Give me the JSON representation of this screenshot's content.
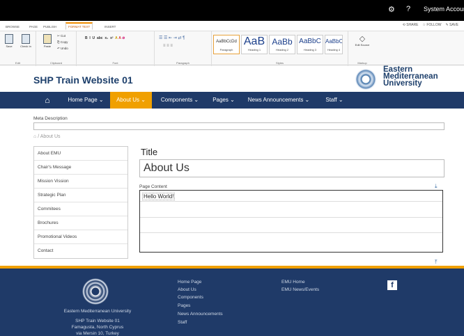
{
  "suitebar": {
    "gear_icon": "gear-icon",
    "help_icon": "help-icon",
    "help": "?",
    "account": "System Account"
  },
  "ribbon_tabs": [
    "BROWSE",
    "PAGE",
    "PUBLISH",
    "FORMAT TEXT",
    "INSERT"
  ],
  "active_ribbon_tab": "FORMAT TEXT",
  "ribbon_actions": {
    "share": "SHARE",
    "follow": "FOLLOW",
    "save": "SAVE"
  },
  "ribbon": {
    "edit_group": {
      "save": "Save",
      "checkin": "Check In",
      "label": "Edit"
    },
    "clipboard": {
      "paste": "Paste",
      "cut": "Cut",
      "copy": "Copy",
      "undo": "Undo",
      "label": "Clipboard"
    },
    "font": {
      "label": "Font"
    },
    "paragraph": {
      "label": "Paragraph"
    },
    "styles": {
      "items": [
        {
          "sample": "AaBbCcDd",
          "name": "Paragraph"
        },
        {
          "sample": "AaB",
          "name": "Heading 1"
        },
        {
          "sample": "AaBb",
          "name": "Heading 2"
        },
        {
          "sample": "AaBbC",
          "name": "Heading 3"
        },
        {
          "sample": "AaBbCc",
          "name": "Heading 4"
        }
      ],
      "label": "Styles"
    },
    "markup": {
      "edit_source": "Edit Source",
      "label": "Markup"
    }
  },
  "site": {
    "title": "SHP Train Website 01",
    "university_line1": "Eastern",
    "university_line2": "Mediterranean",
    "university_line3": "University"
  },
  "topnav": {
    "home_icon": "home-icon",
    "items": [
      "Home Page ⌄",
      "About Us ⌄",
      "Components ⌄",
      "Pages ⌄",
      "News Announcements ⌄",
      "Staff ⌄"
    ],
    "active": "About Us"
  },
  "meta": {
    "label": "Meta Description",
    "value": ""
  },
  "breadcrumb": {
    "home_icon": "home-icon",
    "sep": "/",
    "current": "About Us"
  },
  "leftnav": [
    "About EMU",
    "Chair's Message",
    "Mission Vission",
    "Strategic Plan",
    "Commitees",
    "Brochures",
    "Promotional Videos",
    "Contact"
  ],
  "page": {
    "title_label": "Title",
    "title_value": "About Us",
    "content_label": "Page Content",
    "hello": "Hello World!"
  },
  "footer": {
    "university": "Eastern Mediterranean University",
    "site": "SHP Train Website 01",
    "address1": "Famagusta, North Cyprus",
    "address2": "via Mersin 10, Turkey",
    "links1": [
      "Home Page",
      "About Us",
      "Components",
      "Pages",
      "News Announcements",
      "Staff"
    ],
    "links2": [
      "EMU Home",
      "EMU News/Events"
    ],
    "facebook": "f"
  }
}
